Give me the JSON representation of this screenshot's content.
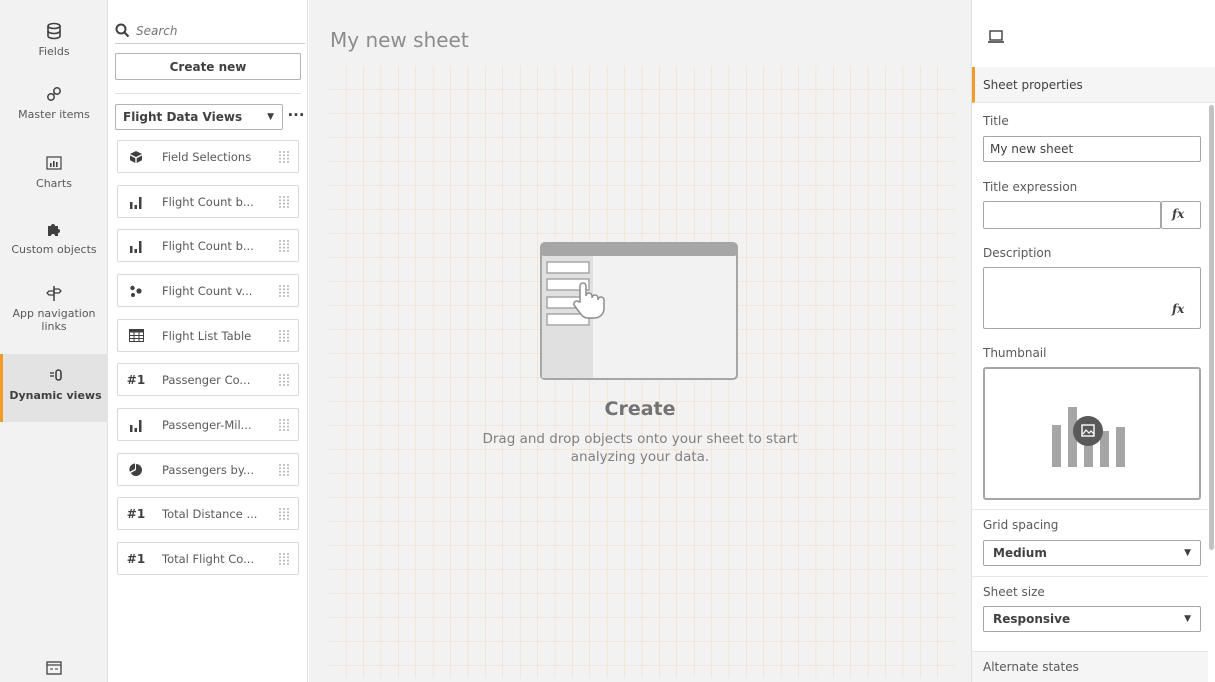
{
  "nav": {
    "items": [
      {
        "label": "Fields",
        "icon": "database-icon"
      },
      {
        "label": "Master items",
        "icon": "link-icon"
      },
      {
        "label": "Charts",
        "icon": "bar-chart-icon"
      },
      {
        "label": "Custom objects",
        "icon": "puzzle-icon"
      },
      {
        "label": "App navigation links",
        "icon": "signpost-icon"
      },
      {
        "label": "Dynamic views",
        "icon": "dynamic-views-icon",
        "active": true
      }
    ],
    "bottom_icon": "app-window-icon"
  },
  "assets": {
    "search_placeholder": "Search",
    "create_new_label": "Create new",
    "view_selector": "Flight Data Views",
    "more_label": "···",
    "items": [
      {
        "label": "Field Selections",
        "icon": "cube-icon"
      },
      {
        "label": "Flight Count b...",
        "icon": "bar-chart-icon"
      },
      {
        "label": "Flight Count b...",
        "icon": "bar-chart-icon"
      },
      {
        "label": "Flight Count v...",
        "icon": "scatter-icon"
      },
      {
        "label": "Flight List Table",
        "icon": "table-icon"
      },
      {
        "label": "Passenger Co...",
        "icon": "kpi-icon",
        "glyph": "#1"
      },
      {
        "label": "Passenger-Mil...",
        "icon": "bar-chart-icon"
      },
      {
        "label": "Passengers by...",
        "icon": "pie-icon"
      },
      {
        "label": "Total Distance ...",
        "icon": "kpi-icon",
        "glyph": "#1"
      },
      {
        "label": "Total Flight Co...",
        "icon": "kpi-icon",
        "glyph": "#1"
      }
    ]
  },
  "sheet": {
    "title": "My new sheet",
    "create_title": "Create",
    "create_desc": "Drag and drop objects onto your sheet to start analyzing your data."
  },
  "props": {
    "header": "Sheet properties",
    "title_label": "Title",
    "title_value": "My new sheet",
    "title_expr_label": "Title expression",
    "title_expr_value": "",
    "fx_label": "fx",
    "description_label": "Description",
    "description_value": "",
    "thumbnail_label": "Thumbnail",
    "grid_spacing_label": "Grid spacing",
    "grid_spacing_value": "Medium",
    "sheet_size_label": "Sheet size",
    "sheet_size_value": "Responsive",
    "alternate_states_label": "Alternate states"
  },
  "colors": {
    "accent": "#f29b27",
    "grid_line": "#f6d8b5",
    "canvas_bg": "#f2f2f2"
  }
}
